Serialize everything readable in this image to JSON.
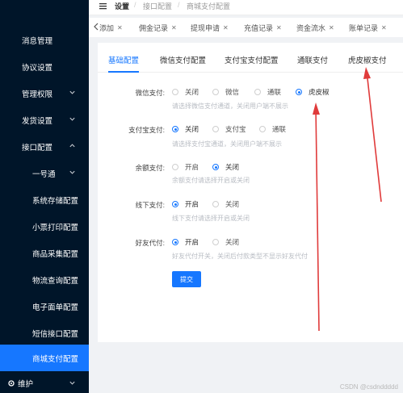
{
  "sidebar": {
    "items": [
      {
        "label": "消息管理",
        "chevron": ""
      },
      {
        "label": "协议设置",
        "chevron": ""
      },
      {
        "label": "管理权限",
        "chevron": "down"
      },
      {
        "label": "发货设置",
        "chevron": "down"
      },
      {
        "label": "接口配置",
        "chevron": "up"
      },
      {
        "label": "一号通",
        "chevron": "down"
      },
      {
        "label": "系统存储配置",
        "chevron": ""
      },
      {
        "label": "小票打印配置",
        "chevron": ""
      },
      {
        "label": "商品采集配置",
        "chevron": ""
      },
      {
        "label": "物流查询配置",
        "chevron": ""
      },
      {
        "label": "电子面单配置",
        "chevron": ""
      },
      {
        "label": "短信接口配置",
        "chevron": ""
      },
      {
        "label": "商城支付配置",
        "chevron": "",
        "active": true
      }
    ],
    "bottom": {
      "label": "维护",
      "icon": "gear-icon"
    },
    "active_color": "#1677ff",
    "bg_color": "#001529"
  },
  "header": {
    "title": "设置",
    "crumb1": "接口配置",
    "crumb2": "商城支付配置",
    "separator": "/"
  },
  "tabs": [
    {
      "label": "添加"
    },
    {
      "label": "佣金记录"
    },
    {
      "label": "提现申请"
    },
    {
      "label": "充值记录"
    },
    {
      "label": "资金流水"
    },
    {
      "label": "账单记录"
    }
  ],
  "subtabs": [
    {
      "label": "基础配置",
      "active": true
    },
    {
      "label": "微信支付配置"
    },
    {
      "label": "支付宝支付配置"
    },
    {
      "label": "通联支付"
    },
    {
      "label": "虎皮椒支付"
    }
  ],
  "form": {
    "wechat": {
      "label": "微信支付:",
      "options": [
        "关闭",
        "微信",
        "通联",
        "虎皮椒"
      ],
      "selected": 3,
      "hint": "请选择微信支付通道，关闭用户端不展示"
    },
    "alipay": {
      "label": "支付宝支付:",
      "options": [
        "关闭",
        "支付宝",
        "通联"
      ],
      "selected": 0,
      "hint": "请选择支付宝通道，关闭用户端不展示"
    },
    "balance": {
      "label": "余额支付:",
      "options": [
        "开启",
        "关闭"
      ],
      "selected": 1,
      "hint": "余额支付请选择开启或关闭"
    },
    "offline": {
      "label": "线下支付:",
      "options": [
        "开启",
        "关闭"
      ],
      "selected": 0,
      "hint": "线下支付请选择开启或关闭"
    },
    "friend": {
      "label": "好友代付:",
      "options": [
        "开启",
        "关闭"
      ],
      "selected": 0,
      "hint": "好友代付开关，关闭后付款类型不显示好友代付"
    },
    "submit_label": "提交"
  },
  "accent_color": "#1677ff",
  "annotation_color": "#e03b3b",
  "watermark": "CSDN @csdnddddd"
}
